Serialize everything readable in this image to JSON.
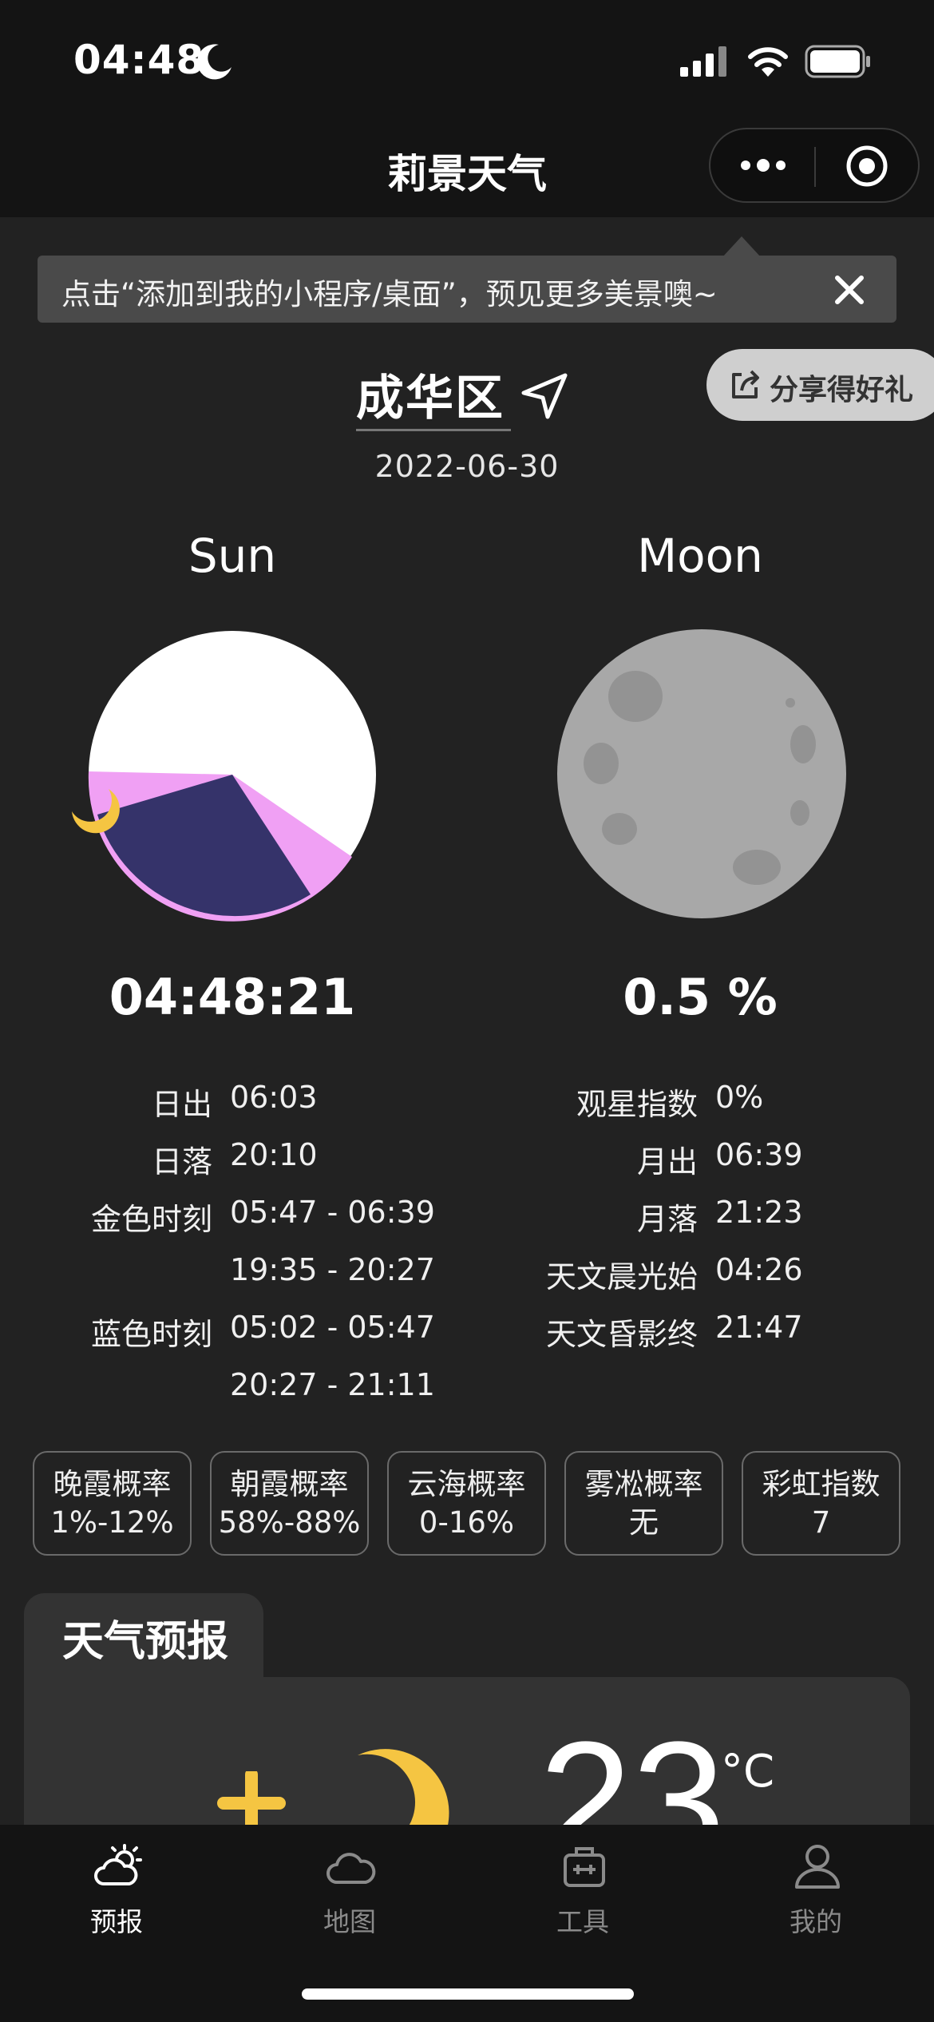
{
  "status_bar": {
    "time": "04:48"
  },
  "nav": {
    "title": "莉景天气"
  },
  "tip": {
    "text": "点击“添加到我的小程序/桌面”，预见更多美景噢~"
  },
  "share": {
    "label": "分享得好礼"
  },
  "location": {
    "name": "成华区",
    "date": "2022-06-30"
  },
  "sun": {
    "heading": "Sun",
    "clock": "04:48:21",
    "rows": [
      {
        "label": "日出",
        "value": "06:03"
      },
      {
        "label": "日落",
        "value": "20:10"
      },
      {
        "label": "金色时刻",
        "value": "05:47 - 06:39"
      },
      {
        "label": "",
        "value": "19:35 - 20:27"
      },
      {
        "label": "蓝色时刻",
        "value": "05:02 - 05:47"
      },
      {
        "label": "",
        "value": "20:27 - 21:11"
      }
    ]
  },
  "moon": {
    "heading": "Moon",
    "illumination": "0.5 %",
    "rows": [
      {
        "label": "观星指数",
        "value": "0%"
      },
      {
        "label": "月出",
        "value": "06:39"
      },
      {
        "label": "月落",
        "value": "21:23"
      },
      {
        "label": "天文晨光始",
        "value": "04:26"
      },
      {
        "label": "天文昏影终",
        "value": "21:47"
      }
    ]
  },
  "chips": [
    {
      "title": "晚霞概率",
      "value": "1%-12%"
    },
    {
      "title": "朝霞概率",
      "value": "58%-88%"
    },
    {
      "title": "云海概率",
      "value": "0-16%"
    },
    {
      "title": "雾凇概率",
      "value": "无"
    },
    {
      "title": "彩虹指数",
      "value": "7"
    }
  ],
  "forecast": {
    "tab_title": "天气预报",
    "temperature": "23",
    "unit": "°C"
  },
  "tabbar": [
    {
      "label": "预报",
      "icon": "weather-icon",
      "active": true
    },
    {
      "label": "地图",
      "icon": "cloud-map-icon",
      "active": false
    },
    {
      "label": "工具",
      "icon": "toolbox-icon",
      "active": false
    },
    {
      "label": "我的",
      "icon": "profile-icon",
      "active": false
    }
  ],
  "colors": {
    "sun_day": "#ffffff",
    "sun_golden": "#f0a0f4",
    "sun_night": "#35336a",
    "moon": "#a8a8a8",
    "moon_icon": "#f5c542"
  }
}
